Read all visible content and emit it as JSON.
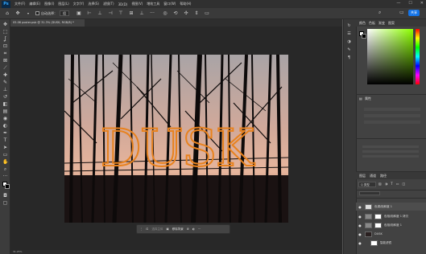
{
  "app": {
    "logo": "Ps"
  },
  "menu": [
    "文件(F)",
    "编辑(E)",
    "图像(I)",
    "图层(L)",
    "文字(Y)",
    "选择(S)",
    "滤镜(T)",
    "3D(D)",
    "视图(V)",
    "增效工具",
    "窗口(W)",
    "帮助(H)"
  ],
  "window_controls": [
    "—",
    "☐",
    "✕"
  ],
  "options": {
    "auto_select": "自动选择：",
    "group": "组",
    "share": "共享"
  },
  "document": {
    "tab_title": "05.06 poster.psb @ 31.3% (DUSK, RGB/8) *"
  },
  "photo_text": "DUSK",
  "context_bar": {
    "select_subject": "选择主体",
    "remove_bg": "移除背景"
  },
  "status": "31.25%",
  "panels": {
    "tabs": [
      "颜色",
      "色板",
      "渐变",
      "图案"
    ],
    "properties": "属性",
    "layers_tab": "图层",
    "channels": "通道",
    "paths": "路径",
    "kind_label": "Q 类型"
  },
  "layers": [
    {
      "name": "色调/饱和度 1"
    },
    {
      "name": "色相/饱和度 1 拷贝"
    },
    {
      "name": "色相/饱和度 1"
    },
    {
      "name": "DUSK"
    },
    {
      "name": "智能滤镜"
    }
  ],
  "colors": {
    "accent": "#1473e6",
    "text_orange": "#e8821e"
  }
}
